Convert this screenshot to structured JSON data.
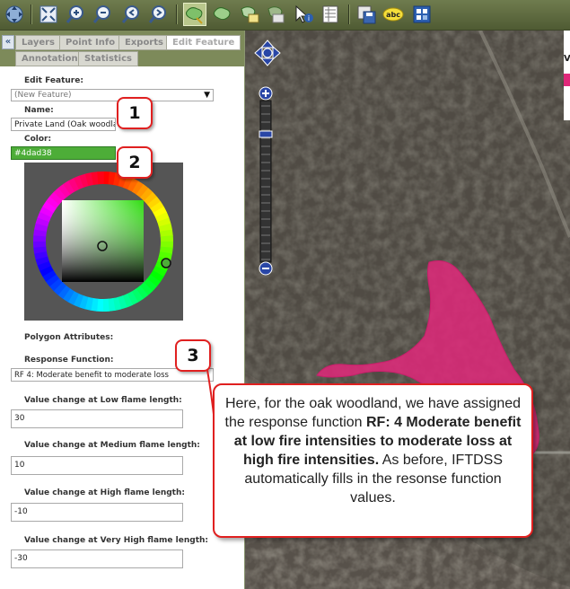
{
  "toolbar": {
    "icons": [
      "pan-zoom-icon",
      "full-extent-icon",
      "zoom-in-icon",
      "zoom-out-icon",
      "zoom-previous-icon",
      "zoom-next-icon",
      "draw-polygon-icon",
      "edit-polygon-icon",
      "erase-icon",
      "select-feature-icon",
      "identify-icon",
      "table-icon",
      "save-icon",
      "label-icon",
      "info-icon"
    ]
  },
  "tabs": {
    "layers": "Layers",
    "point_info": "Point Info",
    "exports": "Exports",
    "edit_feature": "Edit Feature",
    "annotation": "Annotation",
    "statistics": "Statistics",
    "collapse": "«"
  },
  "form": {
    "edit_feature_label": "Edit Feature:",
    "edit_feature_value": "(New Feature)",
    "name_label": "Name:",
    "name_value": "Private Land (Oak woodla",
    "color_label": "Color:",
    "color_value": "#4dad38",
    "polygon_attributes_label": "Polygon Attributes:",
    "response_function_label": "Response Function:",
    "response_function_value": "RF 4: Moderate benefit to moderate loss",
    "low_label": "Value change at Low flame length:",
    "low_value": "30",
    "medium_label": "Value change at Medium flame length:",
    "medium_value": "10",
    "high_label": "Value change at High flame length:",
    "high_value": "-10",
    "very_high_label": "Value change at Very High flame length:",
    "very_high_value": "-30"
  },
  "colors": {
    "selected": "#4dad38",
    "feature": "#e0287a",
    "callout": "#e02020"
  },
  "callouts": {
    "n1": "1",
    "n2": "2",
    "n3": "3"
  },
  "note": {
    "t1": "Here, for the oak woodland, we have assigned the response function ",
    "b1": "RF: 4 Moderate benefit at low fire intensities to moderate loss at high fire intensities.",
    "t2": " As before, IFTDSS automatically fills in the resonse function values."
  },
  "map": {
    "corner_label": "V"
  }
}
